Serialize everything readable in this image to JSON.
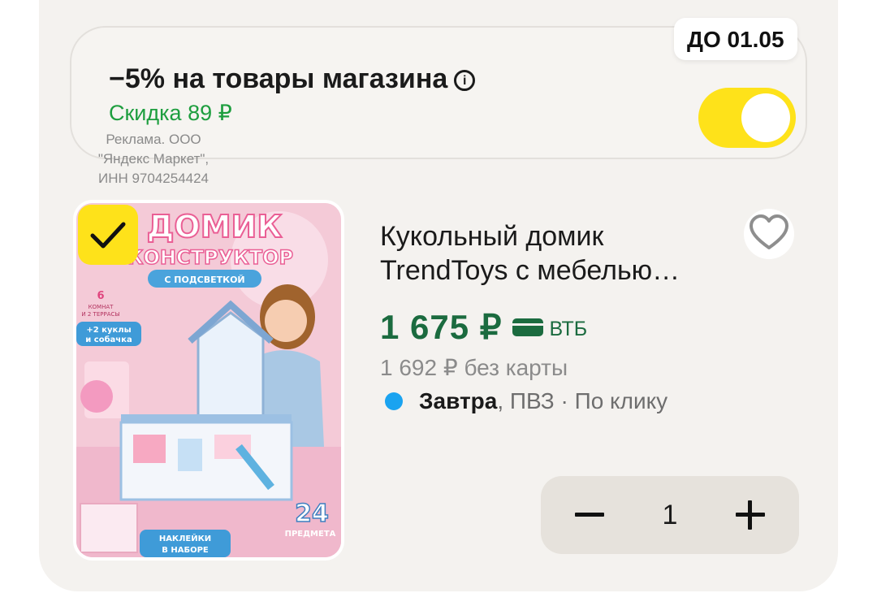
{
  "promo": {
    "title": "−5% на товары магазина",
    "info_icon": "info-icon",
    "discount": "Скидка 89 ₽",
    "deadline": "ДО 01.05",
    "toggle_on": true,
    "toggle_color": "#fee21a"
  },
  "ad_note": "Реклама. ООО \"Яндекс Маркет\", ИНН 9704254424",
  "product": {
    "image": {
      "title_line1": "ДОМИК",
      "title_line2": "КОНСТРУКТОР",
      "subtitle": "С ПОДСВЕТКОЙ",
      "rooms_num": "6",
      "rooms_text1": "КОМНАТ",
      "rooms_text2": "И 2 ТЕРРАСЫ",
      "dolls_line1": "+2 куклы",
      "dolls_line2": "и собачка",
      "count_num": "24",
      "count_text": "ПРЕДМЕТА",
      "stickers_line1": "НАКЛЕЙКИ",
      "stickers_line2": "В НАБОРЕ"
    },
    "selected": true,
    "title": "Кукольный домик TrendToys с мебелью…",
    "price": "1 675 ₽",
    "price_bank": "ВТБ",
    "price_old": "1 692 ₽  без карты",
    "delivery_day": "Завтра",
    "delivery_rest": ", ПВЗ · По клику",
    "accent_price_color": "#1b6b3f",
    "delivery_dot_color": "#1aa3f0"
  },
  "stepper": {
    "minus_icon": "minus-icon",
    "quantity": "1",
    "plus_icon": "plus-icon"
  }
}
